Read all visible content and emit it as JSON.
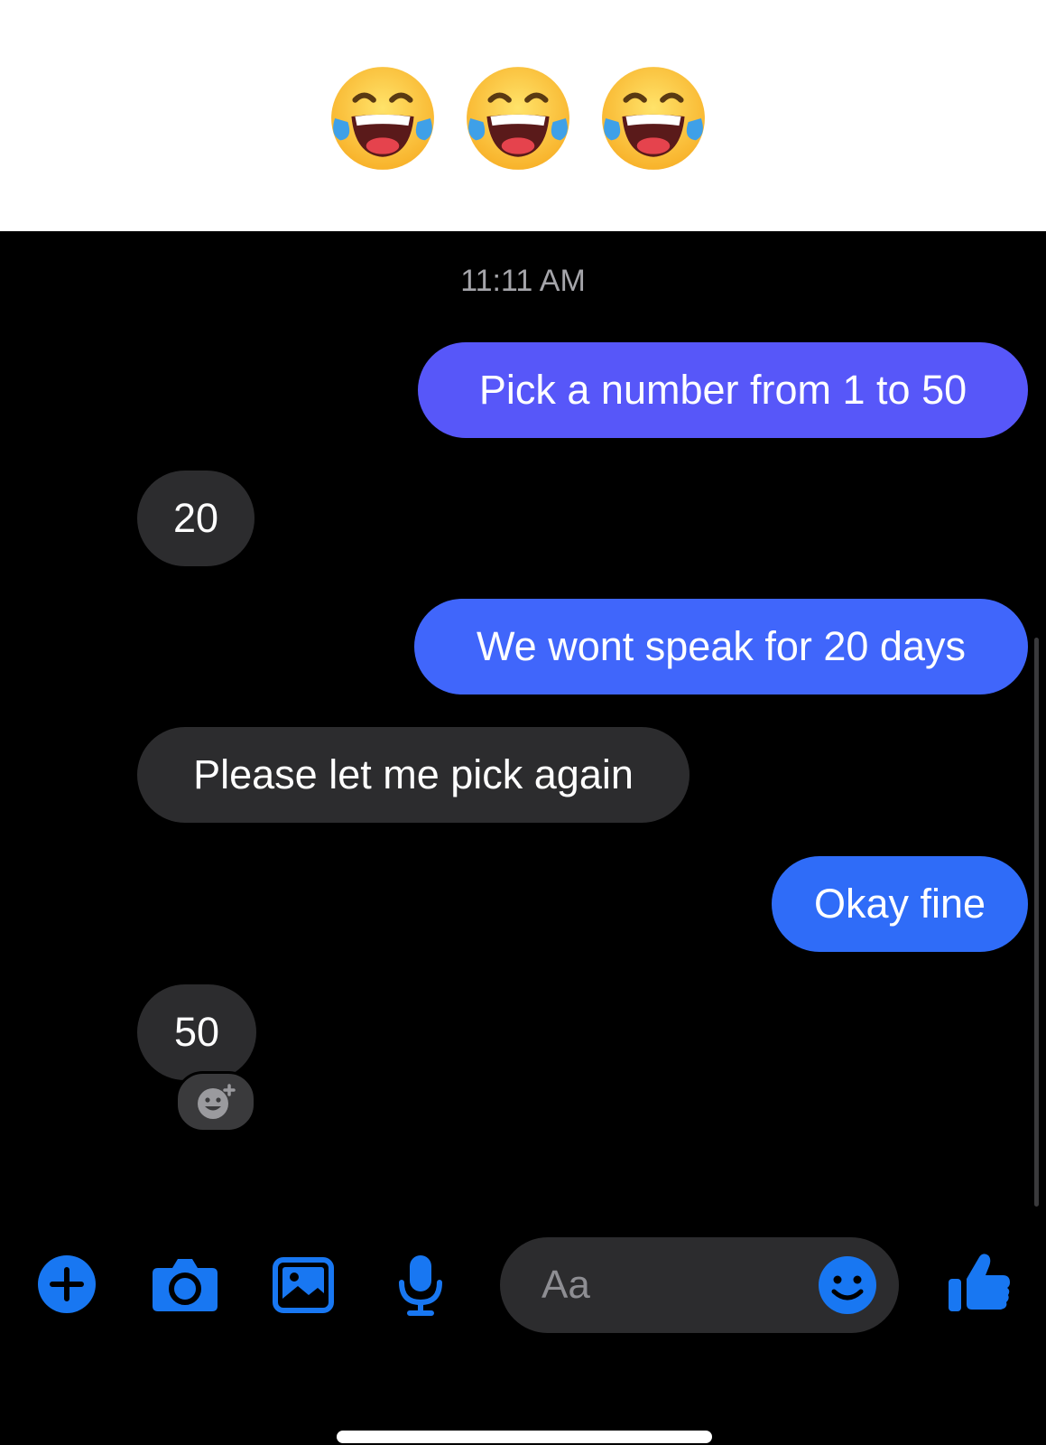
{
  "banner": {
    "emoji": [
      "face-with-tears-of-joy",
      "face-with-tears-of-joy",
      "face-with-tears-of-joy"
    ]
  },
  "conversation": {
    "timestamp": "11:11 AM",
    "messages": [
      {
        "direction": "outgoing",
        "text": "Pick a number from 1 to 50"
      },
      {
        "direction": "incoming",
        "text": "20"
      },
      {
        "direction": "outgoing",
        "text": "We wont speak for 20 days"
      },
      {
        "direction": "incoming",
        "text": "Please let me pick again"
      },
      {
        "direction": "outgoing",
        "text": "Okay fine"
      },
      {
        "direction": "incoming",
        "text": "50"
      }
    ]
  },
  "composer": {
    "placeholder": "Aa",
    "icons": [
      "plus-icon",
      "camera-icon",
      "gallery-icon",
      "microphone-icon",
      "emoji-icon",
      "thumbs-up-icon"
    ]
  },
  "colors": {
    "accent": "#1877f2",
    "outgoing_bubble_top": "#5757f9",
    "outgoing_bubble_bottom": "#2f6cf8",
    "incoming_bubble": "#2c2c2e",
    "background": "#000000"
  }
}
